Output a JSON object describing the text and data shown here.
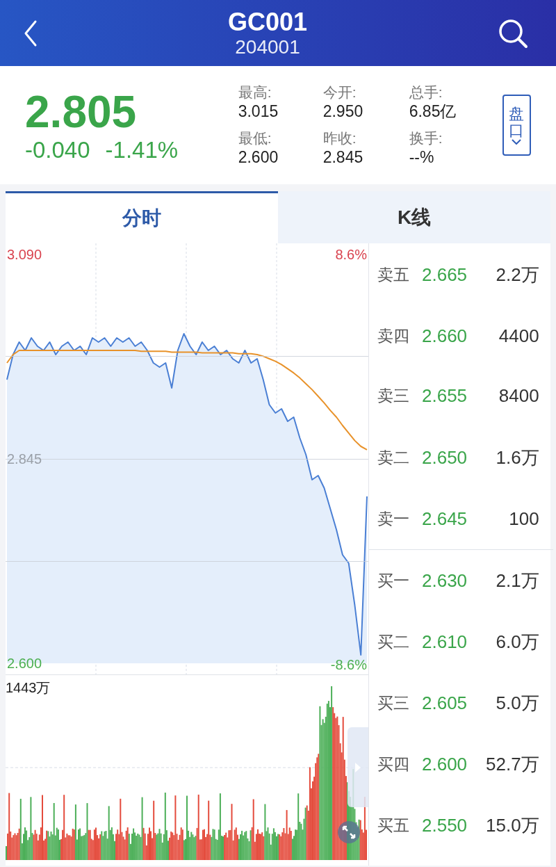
{
  "header": {
    "title": "GC001",
    "code": "204001"
  },
  "quote": {
    "price": "2.805",
    "change": "-0.040",
    "change_pct": "-1.41%",
    "stats": [
      {
        "label": "最高:",
        "value": "3.015"
      },
      {
        "label": "今开:",
        "value": "2.950"
      },
      {
        "label": "总手:",
        "value": "6.85亿"
      },
      {
        "label": "最低:",
        "value": "2.600"
      },
      {
        "label": "昨收:",
        "value": "2.845"
      },
      {
        "label": "换手:",
        "value": "--%"
      }
    ],
    "panel_button": "盘口"
  },
  "tabs": [
    {
      "label": "分时",
      "selected": true
    },
    {
      "label": "K线",
      "selected": false
    }
  ],
  "price_chart": {
    "max_pct": {
      "text": "8.6%",
      "color": "#d9434f"
    },
    "min_pct": {
      "text": "-8.6%",
      "color": "#4caf50"
    },
    "chart_data": {
      "type": "line",
      "ylim": [
        2.6,
        3.09
      ],
      "yticks": [
        {
          "value": 2.6,
          "label": "2.600"
        },
        {
          "value": 2.845,
          "label": "2.845"
        },
        {
          "value": 3.09,
          "label": "3.090"
        }
      ],
      "series": [
        {
          "color": "#4a7fd4",
          "values": [
            2.94,
            2.97,
            2.985,
            2.975,
            2.99,
            2.98,
            2.975,
            2.985,
            2.97,
            2.98,
            2.985,
            2.975,
            2.98,
            2.97,
            2.99,
            2.985,
            2.99,
            2.98,
            2.99,
            2.985,
            2.99,
            2.98,
            2.985,
            2.975,
            2.96,
            2.955,
            2.96,
            2.93,
            2.975,
            2.995,
            2.98,
            2.97,
            2.985,
            2.975,
            2.98,
            2.97,
            2.975,
            2.965,
            2.96,
            2.975,
            2.96,
            2.965,
            2.94,
            2.91,
            2.9,
            2.905,
            2.89,
            2.895,
            2.87,
            2.85,
            2.82,
            2.825,
            2.81,
            2.785,
            2.76,
            2.73,
            2.72,
            2.67,
            2.61,
            2.8
          ]
        },
        {
          "color": "#e8922a",
          "values": [
            2.96,
            2.97,
            2.975,
            2.975,
            2.975,
            2.975,
            2.975,
            2.975,
            2.975,
            2.975,
            2.975,
            2.975,
            2.975,
            2.975,
            2.975,
            2.975,
            2.975,
            2.975,
            2.975,
            2.975,
            2.975,
            2.975,
            2.974,
            2.974,
            2.974,
            2.974,
            2.974,
            2.973,
            2.973,
            2.973,
            2.973,
            2.973,
            2.972,
            2.972,
            2.972,
            2.972,
            2.972,
            2.972,
            2.971,
            2.971,
            2.971,
            2.97,
            2.968,
            2.965,
            2.962,
            2.958,
            2.953,
            2.948,
            2.942,
            2.935,
            2.928,
            2.92,
            2.912,
            2.903,
            2.895,
            2.885,
            2.876,
            2.867,
            2.86,
            2.856
          ]
        }
      ]
    }
  },
  "volume_chart": {
    "max_label": "1443万"
  },
  "order_book": {
    "asks": [
      {
        "label": "卖五",
        "price": "2.665",
        "volume": "2.2万"
      },
      {
        "label": "卖四",
        "price": "2.660",
        "volume": "4400"
      },
      {
        "label": "卖三",
        "price": "2.655",
        "volume": "8400"
      },
      {
        "label": "卖二",
        "price": "2.650",
        "volume": "1.6万"
      },
      {
        "label": "卖一",
        "price": "2.645",
        "volume": "100"
      }
    ],
    "bids": [
      {
        "label": "买一",
        "price": "2.630",
        "volume": "2.1万"
      },
      {
        "label": "买二",
        "price": "2.610",
        "volume": "6.0万"
      },
      {
        "label": "买三",
        "price": "2.605",
        "volume": "5.0万"
      },
      {
        "label": "买四",
        "price": "2.600",
        "volume": "52.7万"
      },
      {
        "label": "买五",
        "price": "2.550",
        "volume": "15.0万"
      }
    ]
  }
}
